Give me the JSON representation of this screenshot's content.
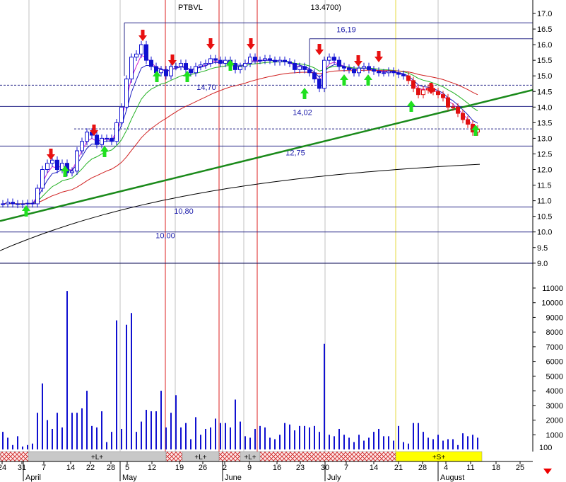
{
  "chart_data": {
    "type": "candlestick",
    "title": "PTBVL",
    "title_suffix": "13.4700)",
    "price_axis": {
      "ylim": [
        9.0,
        17.0
      ],
      "ticks": [
        "17.0",
        "16.5",
        "16.0",
        "15.5",
        "15.0",
        "14.5",
        "14.0",
        "13.5",
        "13.0",
        "12.5",
        "12.0",
        "11.5",
        "11.0",
        "10.5",
        "10.0",
        "9.5",
        "9.0"
      ]
    },
    "volume_axis": {
      "ylim": [
        0,
        11000
      ],
      "ticks": [
        "11000",
        "10000",
        "9000",
        "8000",
        "7000",
        "6000",
        "5000",
        "4000",
        "3000",
        "2000",
        "1000"
      ],
      "corner_label": "100"
    },
    "x_axis": {
      "day_ticks": [
        "24",
        "31",
        "7",
        "14",
        "22",
        "28",
        "5",
        "12",
        "19",
        "26",
        "2",
        "9",
        "16",
        "23",
        "30",
        "7",
        "14",
        "21",
        "28",
        "4",
        "11",
        "18",
        "25"
      ],
      "months": [
        "April",
        "May",
        "June",
        "July",
        "August"
      ]
    },
    "levels": [
      {
        "label": "16,19",
        "value": 16.19
      },
      {
        "label": "14,70",
        "value": 14.7
      },
      {
        "label": "14,02",
        "value": 14.02
      },
      {
        "label": "12,75",
        "value": 12.75
      },
      {
        "label": "10,80",
        "value": 10.8
      },
      {
        "label": "10,00",
        "value": 10.0
      }
    ],
    "bands": [
      {
        "label": "+L+",
        "color": "#c8c8c8"
      },
      {
        "label": "+L+",
        "color": "#c8c8c8"
      },
      {
        "label": "+L+",
        "color": "#c8c8c8"
      },
      {
        "label": "+S+",
        "color": "#ffff00"
      }
    ],
    "series": [
      {
        "name": "close",
        "values": [
          10.9,
          10.95,
          10.9,
          10.88,
          10.9,
          10.92,
          10.9,
          11.4,
          12.0,
          12.2,
          12.3,
          12.0,
          12.2,
          11.9,
          11.95,
          12.6,
          12.9,
          13.2,
          13.1,
          12.8,
          13.0,
          13.0,
          12.9,
          13.5,
          14.0,
          14.9,
          15.6,
          15.7,
          16.0,
          15.5,
          15.3,
          15.1,
          15.2,
          15.0,
          15.3,
          15.3,
          15.4,
          15.2,
          15.1,
          15.3,
          15.35,
          15.4,
          15.55,
          15.5,
          15.4,
          15.5,
          15.4,
          15.2,
          15.3,
          15.4,
          15.6,
          15.5,
          15.5,
          15.55,
          15.5,
          15.45,
          15.5,
          15.45,
          15.4,
          15.2,
          15.3,
          15.2,
          15.1,
          14.9,
          14.6,
          15.5,
          15.6,
          15.5,
          15.3,
          15.25,
          15.2,
          15.1,
          15.25,
          15.3,
          15.2,
          15.15,
          15.1,
          15.1,
          15.15,
          15.1,
          15.05,
          15.0,
          14.85,
          14.6,
          14.4,
          14.55,
          14.6,
          14.5,
          14.4,
          14.3,
          14.0,
          14.0,
          13.8,
          13.6,
          13.45,
          13.2,
          13.3
        ],
        "ylim": [
          9.0,
          17.0
        ]
      },
      {
        "name": "volume",
        "values": [
          1200,
          800,
          300,
          900,
          200,
          300,
          400,
          2500,
          4500,
          2000,
          1400,
          2500,
          1500,
          10800,
          2500,
          2500,
          2800,
          4000,
          1600,
          1500,
          2600,
          500,
          1200,
          8800,
          1400,
          8500,
          9300,
          1200,
          1900,
          2700,
          2600,
          2600,
          4000,
          1500,
          2500,
          3700,
          1500,
          1800,
          700,
          2200,
          1000,
          1400,
          1500,
          2100,
          1800,
          1800,
          1500,
          3400,
          1900,
          900,
          800,
          1400,
          1600,
          1500,
          800,
          700,
          1000,
          1800,
          1700,
          1300,
          1600,
          1600,
          1500,
          1600,
          1200,
          7200,
          1000,
          900,
          1400,
          1000,
          800,
          500,
          1000,
          600,
          800,
          1200,
          1400,
          900,
          900,
          600,
          1600,
          500,
          400,
          1800,
          1800,
          1200,
          800,
          700,
          1000,
          600,
          700,
          700,
          300,
          1100,
          900,
          1000,
          800
        ],
        "ylim": [
          0,
          11000
        ]
      }
    ]
  }
}
